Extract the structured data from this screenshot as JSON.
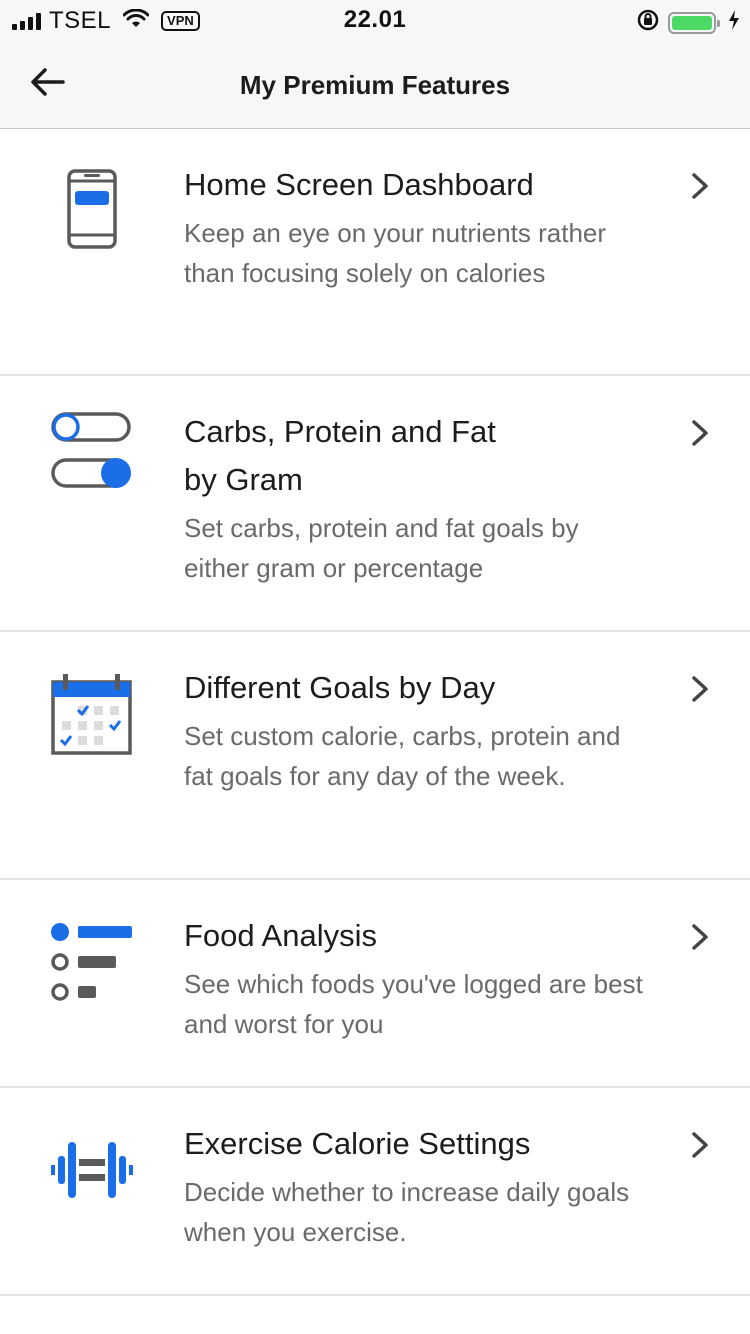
{
  "status_bar": {
    "carrier": "TSEL",
    "vpn": "VPN",
    "time": "22.01"
  },
  "nav": {
    "title": "My Premium Features",
    "back_icon": "arrow-left-icon"
  },
  "colors": {
    "accent": "#1a6ee8",
    "icon_gray": "#5a5a5a",
    "divider": "#e2e2e2"
  },
  "features": [
    {
      "icon": "phone-dashboard-icon",
      "title": "Home Screen Dashboard",
      "description": "Keep an eye on your nutrients rather than focusing solely on calories"
    },
    {
      "icon": "toggle-switches-icon",
      "title_line1": "Carbs, Protein and Fat",
      "title_line2": "by Gram",
      "description": "Set carbs, protein and fat goals by either gram or percentage"
    },
    {
      "icon": "calendar-icon",
      "title": "Different Goals by Day",
      "description": "Set custom calorie, carbs, protein and fat goals for any day of the week."
    },
    {
      "icon": "food-analysis-icon",
      "title": "Food Analysis",
      "description": "See which foods you've logged are best and worst for you"
    },
    {
      "icon": "dumbbell-icon",
      "title": "Exercise Calorie Settings",
      "description": "Decide whether to increase daily goals when you exercise."
    }
  ]
}
